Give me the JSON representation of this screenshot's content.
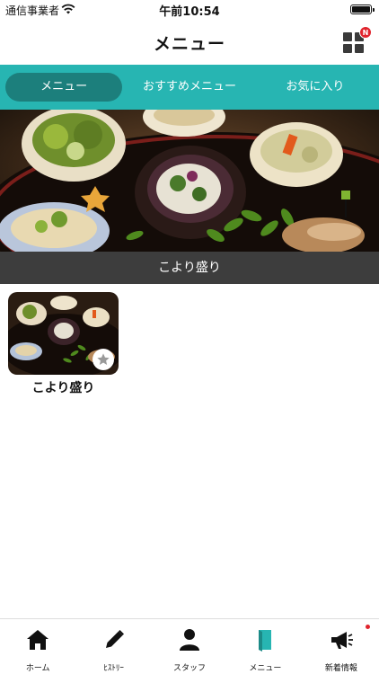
{
  "status": {
    "carrier": "通信事業者",
    "time": "午前10:54"
  },
  "nav": {
    "title": "メニュー",
    "badge": "N"
  },
  "tabs": [
    {
      "label": "メニュー",
      "active": true
    },
    {
      "label": "おすすめメニュー",
      "active": false
    },
    {
      "label": "お気に入り",
      "active": false
    }
  ],
  "hero": {
    "caption": "こより盛り"
  },
  "items": [
    {
      "title": "こより盛り",
      "favorite": false
    }
  ],
  "tabbar": [
    {
      "label": "ホーム",
      "icon": "home-icon"
    },
    {
      "label": "ﾋｽﾄﾘｰ",
      "icon": "pencil-icon"
    },
    {
      "label": "スタッフ",
      "icon": "person-icon"
    },
    {
      "label": "メニュー",
      "icon": "book-icon",
      "active": true
    },
    {
      "label": "新着情報",
      "icon": "megaphone-icon",
      "dot": true
    }
  ],
  "colors": {
    "accent": "#27b5b2",
    "tab_active": "#1c7f7c",
    "caption_bg": "#3d3d3d",
    "badge": "#e0242d"
  }
}
